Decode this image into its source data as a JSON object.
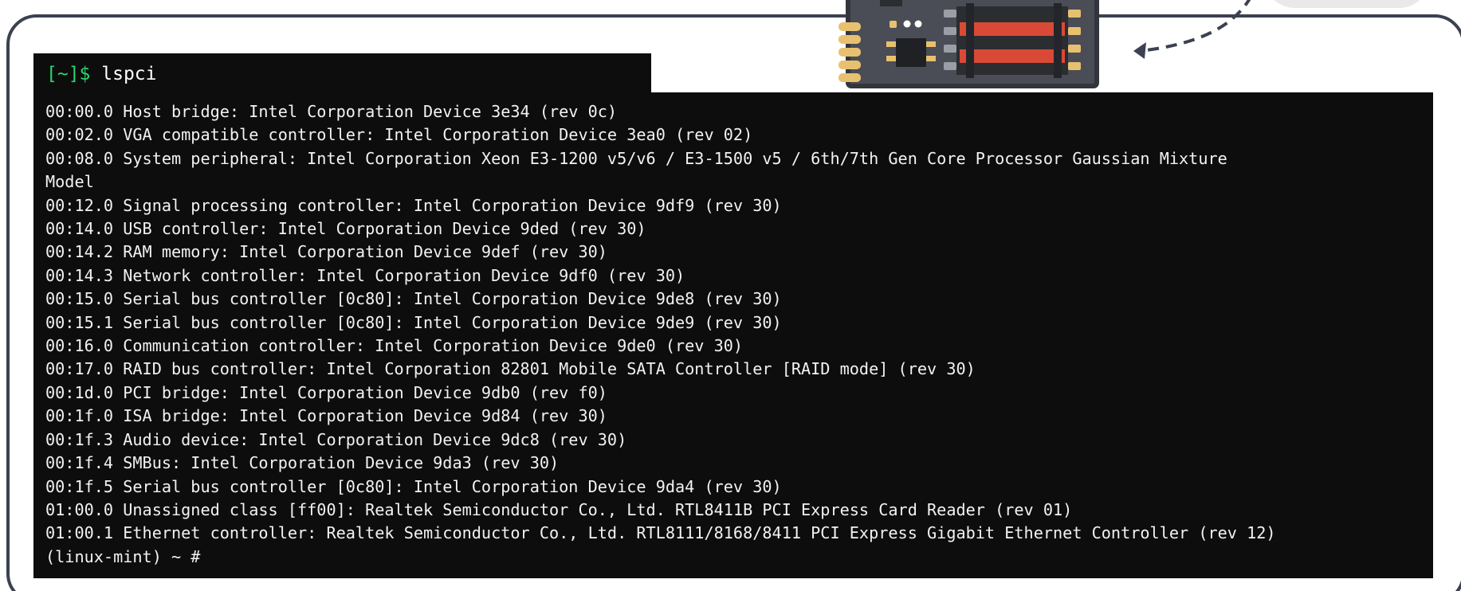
{
  "prompt": {
    "ps1": "[~]$",
    "command": "lspci"
  },
  "output_lines": [
    "00:00.0 Host bridge: Intel Corporation Device 3e34 (rev 0c)",
    "00:02.0 VGA compatible controller: Intel Corporation Device 3ea0 (rev 02)",
    "00:08.0 System peripheral: Intel Corporation Xeon E3-1200 v5/v6 / E3-1500 v5 / 6th/7th Gen Core Processor Gaussian Mixture",
    "Model",
    "00:12.0 Signal processing controller: Intel Corporation Device 9df9 (rev 30)",
    "00:14.0 USB controller: Intel Corporation Device 9ded (rev 30)",
    "00:14.2 RAM memory: Intel Corporation Device 9def (rev 30)",
    "00:14.3 Network controller: Intel Corporation Device 9df0 (rev 30)",
    "00:15.0 Serial bus controller [0c80]: Intel Corporation Device 9de8 (rev 30)",
    "00:15.1 Serial bus controller [0c80]: Intel Corporation Device 9de9 (rev 30)",
    "00:16.0 Communication controller: Intel Corporation Device 9de0 (rev 30)",
    "00:17.0 RAID bus controller: Intel Corporation 82801 Mobile SATA Controller [RAID mode] (rev 30)",
    "00:1d.0 PCI bridge: Intel Corporation Device 9db0 (rev f0)",
    "00:1f.0 ISA bridge: Intel Corporation Device 9d84 (rev 30)",
    "00:1f.3 Audio device: Intel Corporation Device 9dc8 (rev 30)",
    "00:1f.4 SMBus: Intel Corporation Device 9da3 (rev 30)",
    "00:1f.5 Serial bus controller [0c80]: Intel Corporation Device 9da4 (rev 30)",
    "01:00.0 Unassigned class [ff00]: Realtek Semiconductor Co., Ltd. RTL8411B PCI Express Card Reader (rev 01)",
    "01:00.1 Ethernet controller: Realtek Semiconductor Co., Ltd. RTL8111/8168/8411 PCI Express Gigabit Ethernet Controller (rev 12)",
    "(linux-mint) ~ #"
  ],
  "colors": {
    "terminal_bg": "#0d0d0e",
    "prompt_green": "#2bd46b",
    "text": "#f2f2f2",
    "frame": "#3b4150",
    "chip_board": "#4a4d55",
    "chip_pins": "#e8c170",
    "chip_bars": "#d84a36"
  },
  "icons": {
    "chip": "pci-chip-icon",
    "arrow": "dashed-curved-arrow-icon"
  }
}
